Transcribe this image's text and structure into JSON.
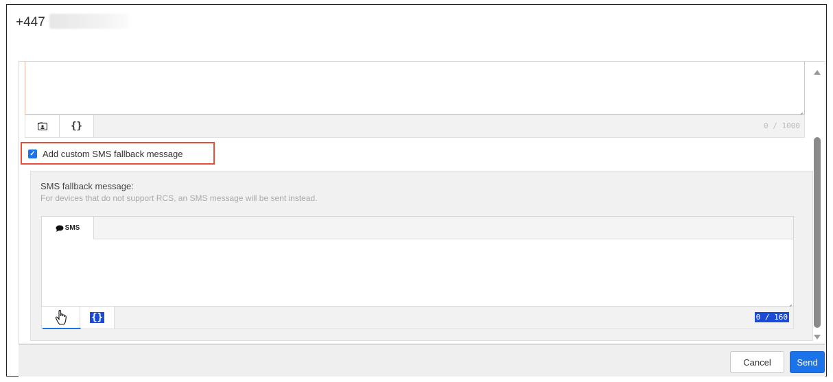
{
  "header": {
    "phone_prefix": "+447"
  },
  "rcs_message": {
    "counter": "0 / 1000",
    "toolbar": [
      {
        "name": "contact-card-icon"
      },
      {
        "name": "variables-icon",
        "label": "{}"
      }
    ]
  },
  "fallback": {
    "checkbox_label": "Add custom SMS fallback message",
    "checked": true,
    "panel_title": "SMS fallback message:",
    "panel_description": "For devices that do not support RCS, an SMS message will be sent instead.",
    "tab_label": "SMS",
    "counter": "0 / 160",
    "variables_label": "{}"
  },
  "footer": {
    "cancel_label": "Cancel",
    "send_label": "Send"
  },
  "colors": {
    "accent": "#1a73e8",
    "highlight_border": "#e74c3c",
    "selection": "#1a4bd6"
  }
}
